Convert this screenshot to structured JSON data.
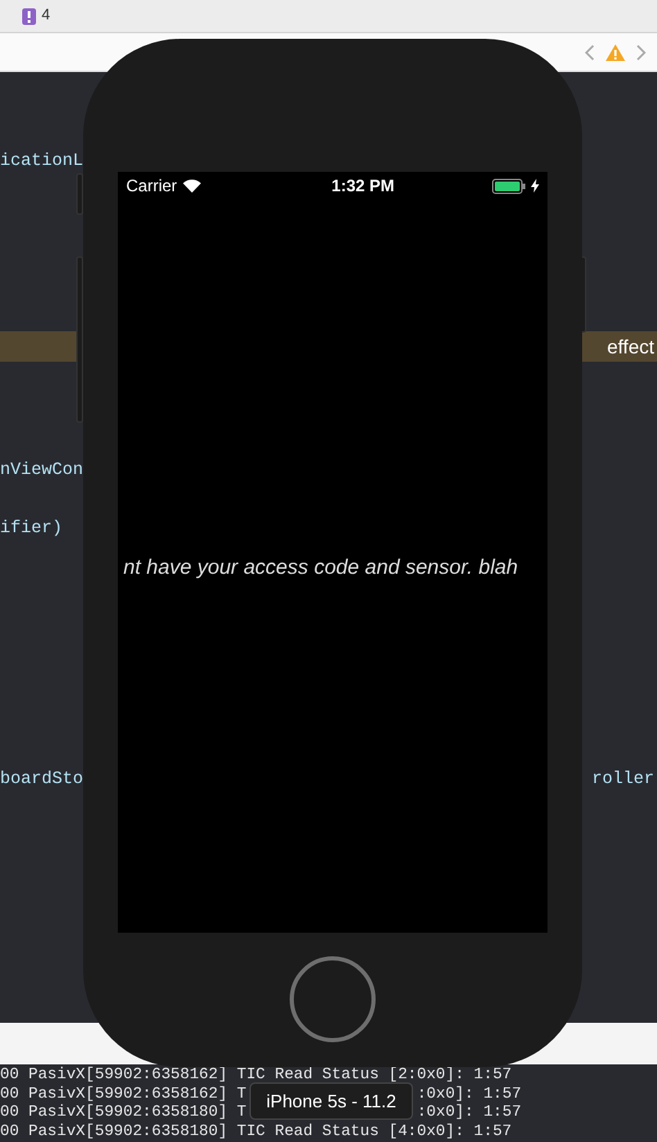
{
  "toolbar": {
    "issue_count": "4"
  },
  "editor": {
    "lines": [
      {
        "left": "icationL",
        "highlighted": false
      },
      {
        "right": "effect",
        "highlighted": true
      },
      {
        "left": "nViewCon",
        "highlighted": false
      },
      {
        "left": "ifier)",
        "highlighted": false
      },
      {
        "left": "boardSto",
        "right": "roller",
        "highlighted": false
      }
    ]
  },
  "simulator": {
    "status_bar": {
      "carrier": "Carrier",
      "time": "1:32 PM",
      "charging": true
    },
    "message": "nt have your access code and sensor. blah",
    "tooltip": "iPhone 5s - 11.2"
  },
  "console": {
    "lines": [
      {
        "parts": [
          "00 PasivX[59902:6358162] TIC Read Status [2:0x0]: 1:57"
        ]
      },
      {
        "parts": [
          "00 PasivX[59902:6358162] T",
          ":0x0]: 1:57"
        ]
      },
      {
        "parts": [
          "00 PasivX[59902:6358180] T",
          ":0x0]: 1:57"
        ]
      },
      {
        "parts": [
          "00 PasivX[59902:6358180] TIC Read Status [4:0x0]: 1:57"
        ]
      }
    ]
  }
}
